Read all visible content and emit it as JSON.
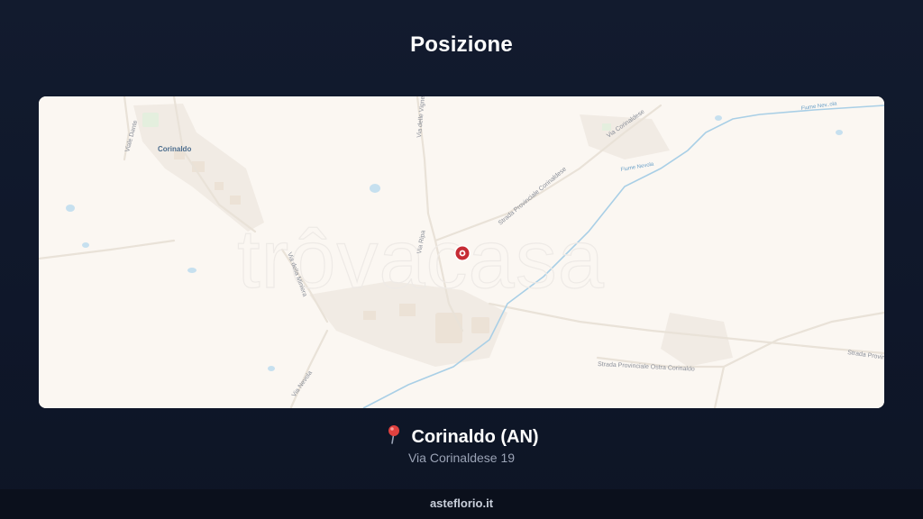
{
  "header": {
    "title": "Posizione"
  },
  "map": {
    "town_label": "Corinaldo",
    "street_labels": [
      "Viale Dante",
      "Via delle Vigne",
      "Via Corinaldese",
      "Strada Provinciale Corinaldese",
      "Via Ripa",
      "Via della Miniera",
      "Strada Provinciale Ostra Corinaldo",
      "Strada Provinciale",
      "Via Nevola"
    ],
    "water_labels": [
      "Fiume Nevola",
      "Fiume Nev..ola"
    ],
    "watermark": "trôvacasa",
    "marker": {
      "name": "location-marker-icon",
      "color": "#c62b34"
    }
  },
  "location": {
    "pin_icon": "round-pushpin-icon",
    "place": "Corinaldo (AN)",
    "address": "Via Corinaldese 19"
  },
  "footer": {
    "brand": "asteflorio.it"
  },
  "colors": {
    "background": "#0f172a",
    "map_land": "#fbf7f2",
    "river": "#a9cfe6",
    "marker": "#c62b34"
  }
}
